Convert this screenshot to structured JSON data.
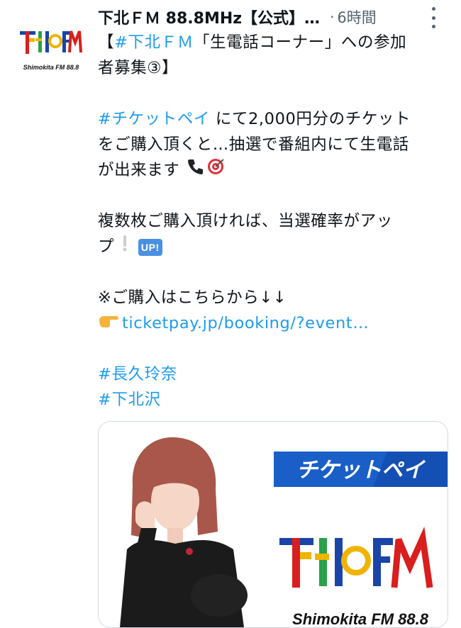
{
  "account": {
    "name": "下北ＦＭ 88.8MHz【公式】…",
    "time_separator": "·",
    "time": "6時間",
    "avatar_logo_text": "下北FM",
    "avatar_caption": "Shimokita FM 88.8"
  },
  "tweet": {
    "line1_prefix": "【",
    "line1_hashtag": "#下北ＦＭ",
    "line1_suffix": "「生電話コーナー」への参加",
    "line2": "者募集③】",
    "line3_hashtag": "#チケットペイ",
    "line3_suffix": " にて2,000円分のチケット",
    "line4": "をご購入頂くと…抽選で番組内にて生電話",
    "line5": "が出来ます",
    "line6": "複数枚ご購入頂ければ、当選確率がアッ",
    "line7": "プ",
    "up_badge": "UP!",
    "line8": "※ご購入はこちらから↓↓",
    "link": "ticketpay.jp/booking/?event…",
    "hashtag_a": "#長久玲奈",
    "hashtag_b": "#下北沢"
  },
  "media": {
    "ticketpay_logo": "チケットペイ",
    "shimokita_caption": "Shimokita FM 88.8"
  },
  "icons": [
    "telephone-icon",
    "target-icon",
    "exclamation-icon",
    "pointing-hand-icon",
    "more-dots-icon"
  ],
  "colors": {
    "link": "#1d9bf0",
    "muted": "#536471",
    "ticketpay_blue": "#1a5fc8"
  }
}
